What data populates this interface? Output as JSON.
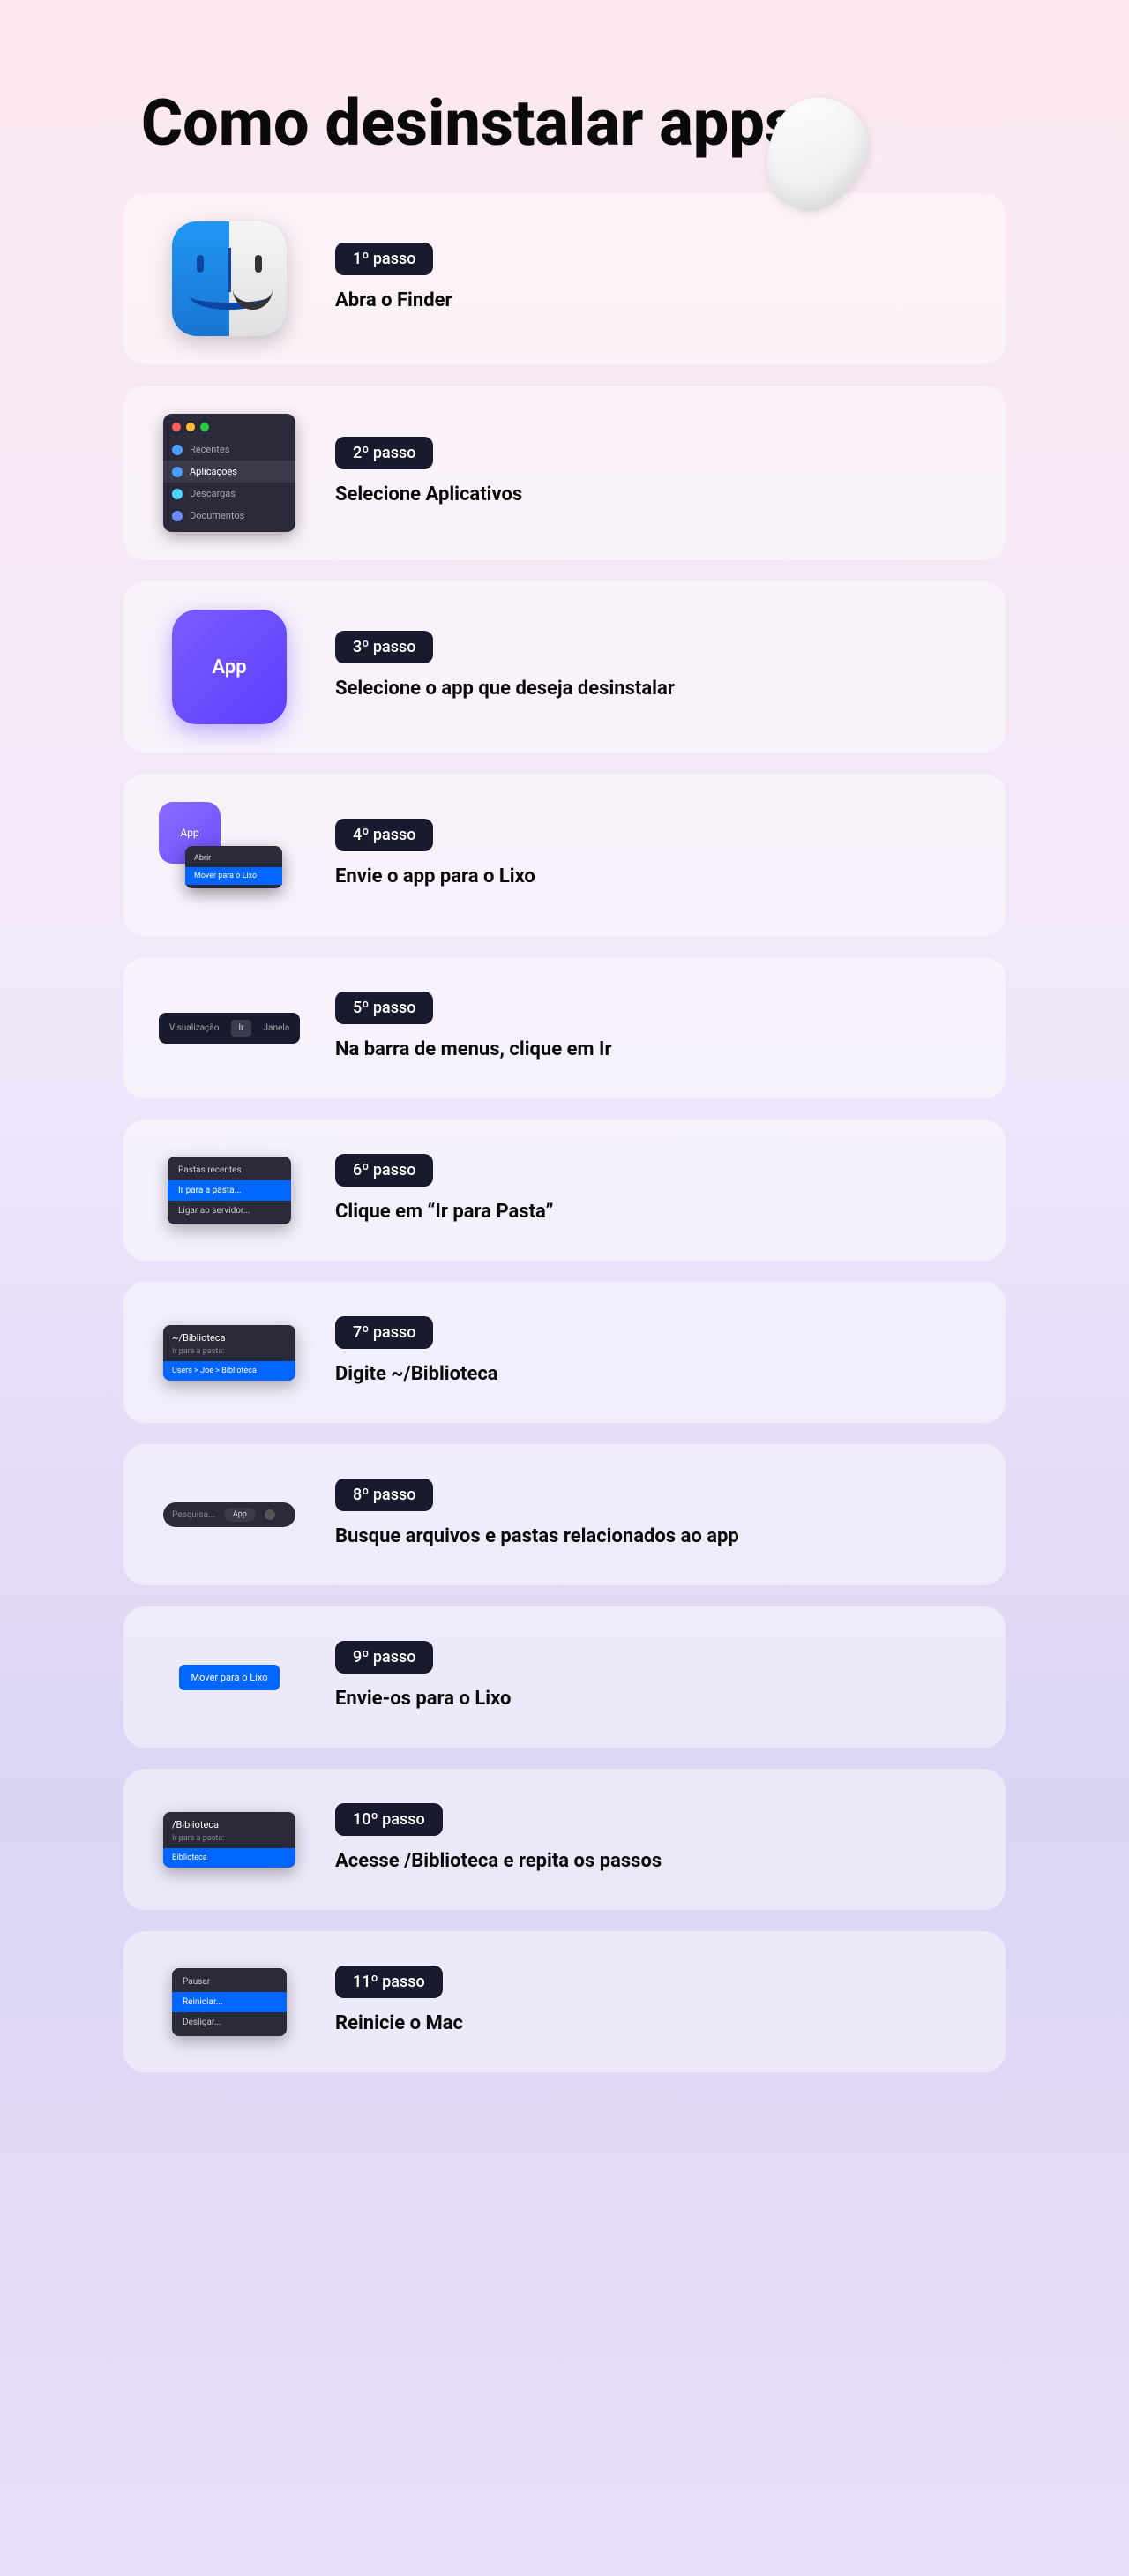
{
  "title": "Como desinstalar apps",
  "steps": [
    {
      "badge": "1º passo",
      "text": "Abra o Finder"
    },
    {
      "badge": "2º passo",
      "text": "Selecione Aplicativos"
    },
    {
      "badge": "3º passo",
      "text": "Selecione o app que deseja desinstalar"
    },
    {
      "badge": "4º passo",
      "text": "Envie o app para o Lixo"
    },
    {
      "badge": "5º passo",
      "text": "Na barra de menus, clique em Ir"
    },
    {
      "badge": "6º passo",
      "text": "Clique em “Ir para Pasta”"
    },
    {
      "badge": "7º passo",
      "text": "Digite ~/Biblioteca"
    },
    {
      "badge": "8º passo",
      "text": "Busque arquivos e pastas relacionados ao app"
    },
    {
      "badge": "9º passo",
      "text": "Envie-os para o Lixo"
    },
    {
      "badge": "10º passo",
      "text": "Acesse /Biblioteca e repita os passos"
    },
    {
      "badge": "11º passo",
      "text": "Reinicie o Mac"
    }
  ],
  "illus": {
    "s2": {
      "i0": "Recentes",
      "i1": "Aplicações",
      "i2": "Descargas",
      "i3": "Documentos"
    },
    "s3": {
      "app": "App"
    },
    "s4": {
      "app": "App",
      "m0": "Abrir",
      "m1": "Mover para o Lixo"
    },
    "s5": {
      "l": "Visualização",
      "c": "Ir",
      "r": "Janela"
    },
    "s6": {
      "i0": "Pastas recentes",
      "i1": "Ir para a pasta...",
      "i2": "Ligar ao servidor..."
    },
    "s7": {
      "title": "~/Biblioteca",
      "sub": "Ir para a pasta:",
      "path": "Users > Joe > Biblioteca"
    },
    "s8": {
      "ph": "Pesquisa...",
      "chip": "App"
    },
    "s9": {
      "btn": "Mover para o Lixo"
    },
    "s10": {
      "title": "/Biblioteca",
      "sub": "Ir para a pasta:",
      "path": "Biblioteca"
    },
    "s11": {
      "i0": "Pausar",
      "i1": "Reiniciar...",
      "i2": "Desligar..."
    }
  }
}
